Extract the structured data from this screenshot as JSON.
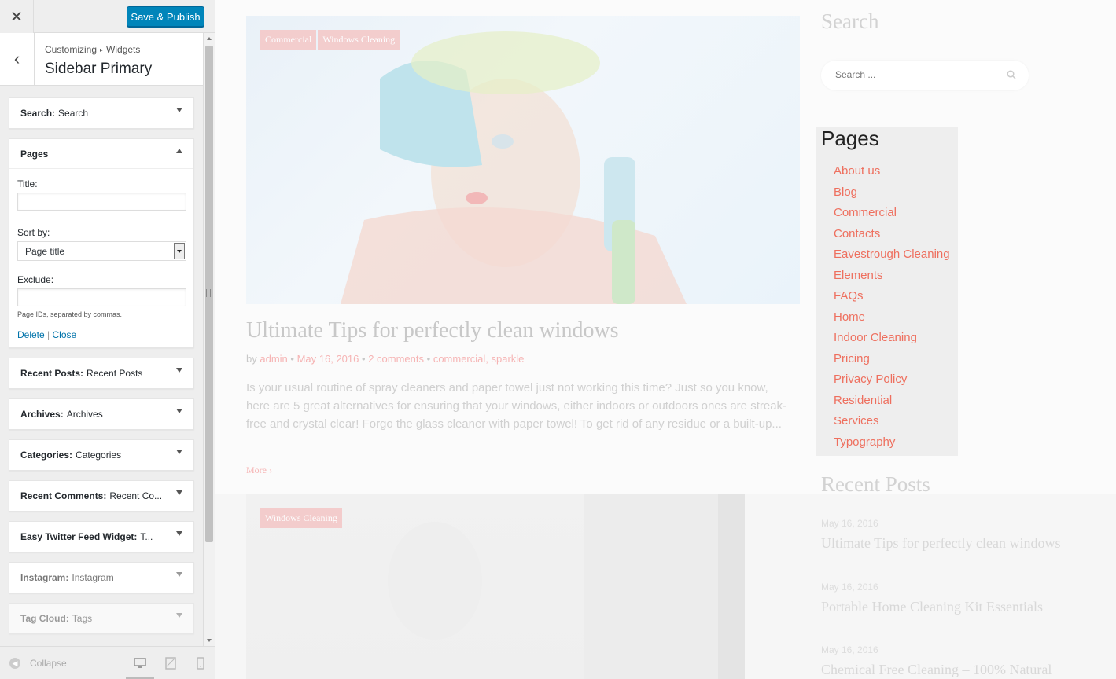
{
  "customizer": {
    "close_icon": "close-icon",
    "save_label": "Save & Publish",
    "breadcrumb": {
      "root": "Customizing",
      "child": "Widgets"
    },
    "section_title": "Sidebar Primary",
    "widgets": [
      {
        "type": "Search",
        "title": "Search"
      },
      {
        "type": "Pages",
        "title": ""
      },
      {
        "type": "Recent Posts",
        "title": "Recent Posts"
      },
      {
        "type": "Archives",
        "title": "Archives"
      },
      {
        "type": "Categories",
        "title": "Categories"
      },
      {
        "type": "Recent Comments",
        "title": "Recent Co..."
      },
      {
        "type": "Easy Twitter Feed Widget",
        "title": "T..."
      },
      {
        "type": "Instagram",
        "title": "Instagram"
      },
      {
        "type": "Tag Cloud",
        "title": "Tags"
      }
    ],
    "pages_form": {
      "title_label": "Title:",
      "title_value": "",
      "sort_label": "Sort by:",
      "sort_value": "Page title",
      "exclude_label": "Exclude:",
      "exclude_value": "",
      "exclude_help": "Page IDs, separated by commas.",
      "delete_label": "Delete",
      "separator": "|",
      "close_label": "Close"
    },
    "footer": {
      "collapse_label": "Collapse"
    }
  },
  "preview": {
    "post1": {
      "tags": [
        "Commercial",
        "Windows Cleaning"
      ],
      "title": "Ultimate Tips for perfectly clean windows",
      "meta": {
        "by": "by",
        "author": "admin",
        "date": "May 16, 2016",
        "comments": "2 comments",
        "categories": "commercial, sparkle"
      },
      "excerpt": "Is your usual routine of spray cleaners and paper towel just not working this time? Just so you know, here are 5 great alternatives for ensuring that your windows, either indoors or outdoors ones are streak-free and crystal clear! Forgo the glass cleaner with paper towel! To get rid of any residue or a built-up...",
      "more": "More"
    },
    "post2": {
      "tags": [
        "Windows Cleaning"
      ]
    },
    "sidebar": {
      "search_title": "Search",
      "search_placeholder": "Search ...",
      "pages_title": "Pages",
      "pages": [
        "About us",
        "Blog",
        "Commercial",
        "Contacts",
        "Eavestrough Cleaning",
        "Elements",
        "FAQs",
        "Home",
        "Indoor Cleaning",
        "Pricing",
        "Privacy Policy",
        "Residential",
        "Services",
        "Typography"
      ],
      "recent_title": "Recent Posts",
      "recent": [
        {
          "date": "May 16, 2016",
          "title": "Ultimate Tips for perfectly clean windows"
        },
        {
          "date": "May 16, 2016",
          "title": "Portable Home Cleaning Kit Essentials"
        },
        {
          "date": "May 16, 2016",
          "title": "Chemical Free Cleaning – 100% Natural"
        }
      ]
    },
    "colors": {
      "accent": "#ee6f5e",
      "primary_button": "#0085ba"
    }
  }
}
